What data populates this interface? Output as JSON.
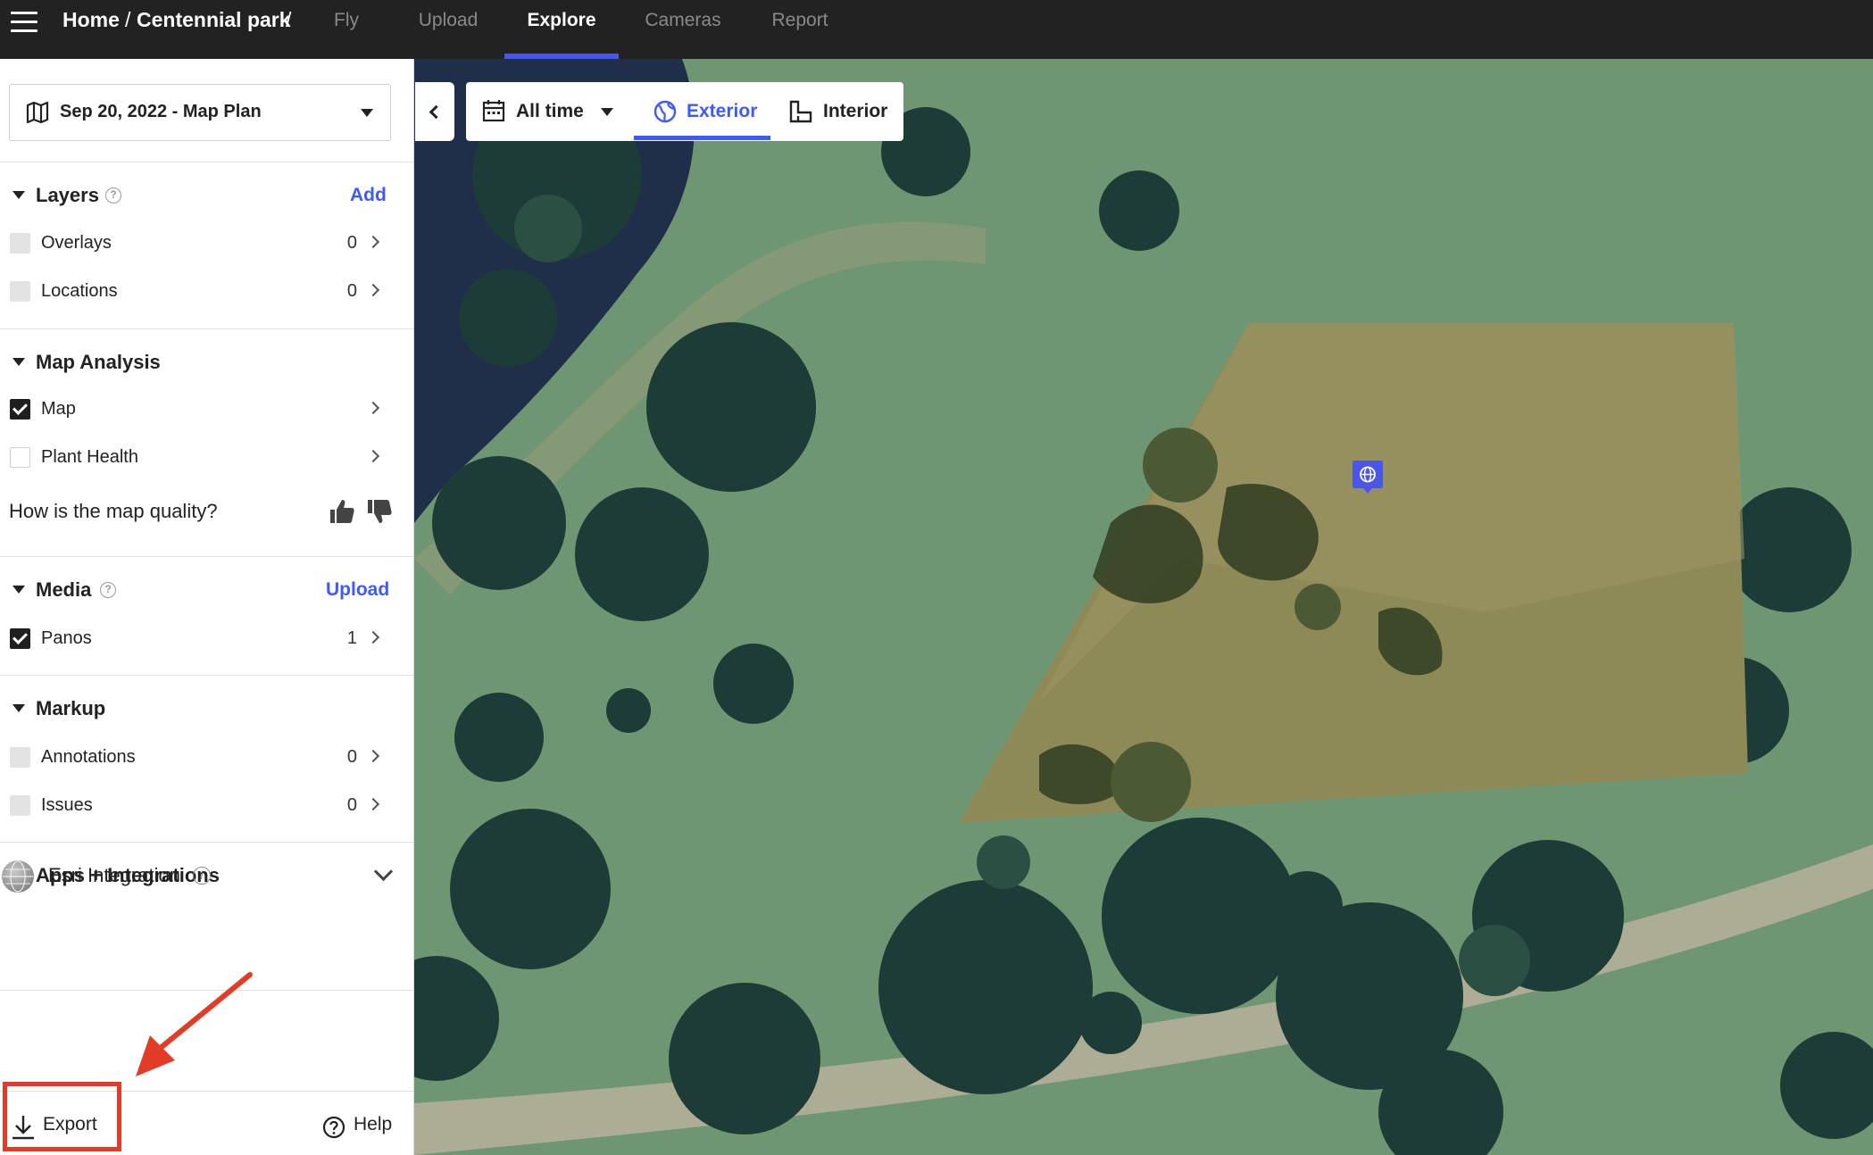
{
  "header": {
    "breadcrumb_home": "Home",
    "breadcrumb_sep": "/",
    "breadcrumb_project": "Centennial park",
    "breadcrumb_sep2": "/",
    "tabs": [
      {
        "label": "Fly",
        "active": false
      },
      {
        "label": "Upload",
        "active": false
      },
      {
        "label": "Explore",
        "active": true
      },
      {
        "label": "Cameras",
        "active": false
      },
      {
        "label": "Report",
        "active": false
      }
    ],
    "accent_color": "#4a57e6"
  },
  "sidebar": {
    "plan_select": {
      "value": "Sep 20, 2022 - Map Plan",
      "icon": "map-icon"
    },
    "layers": {
      "title": "Layers",
      "action": "Add",
      "items": [
        {
          "label": "Overlays",
          "count": "0",
          "checked": false
        },
        {
          "label": "Locations",
          "count": "0",
          "checked": false
        }
      ]
    },
    "map_analysis": {
      "title": "Map Analysis",
      "items": [
        {
          "label": "Map",
          "checked": true
        },
        {
          "label": "Plant Health",
          "checked": false
        }
      ],
      "quality_question": "How is the map quality?"
    },
    "media": {
      "title": "Media",
      "action": "Upload",
      "items": [
        {
          "label": "Panos",
          "count": "1",
          "checked": true
        }
      ]
    },
    "markup": {
      "title": "Markup",
      "items": [
        {
          "label": "Annotations",
          "count": "0",
          "checked": false
        },
        {
          "label": "Issues",
          "count": "0",
          "checked": false
        }
      ]
    },
    "apps": {
      "title": "Apps + Integrations",
      "esri_label": "Esri Integration",
      "esri_info": "i"
    },
    "footer": {
      "export_label": "Export",
      "help_label": "Help"
    },
    "help_glyph": "?"
  },
  "map_toolbar": {
    "date_filter": "All time",
    "view_tabs": [
      {
        "label": "Exterior",
        "active": true
      },
      {
        "label": "Interior",
        "active": false
      }
    ],
    "active_color": "#3d5afe"
  },
  "annotation": {
    "highlight_color": "#e23b26"
  }
}
